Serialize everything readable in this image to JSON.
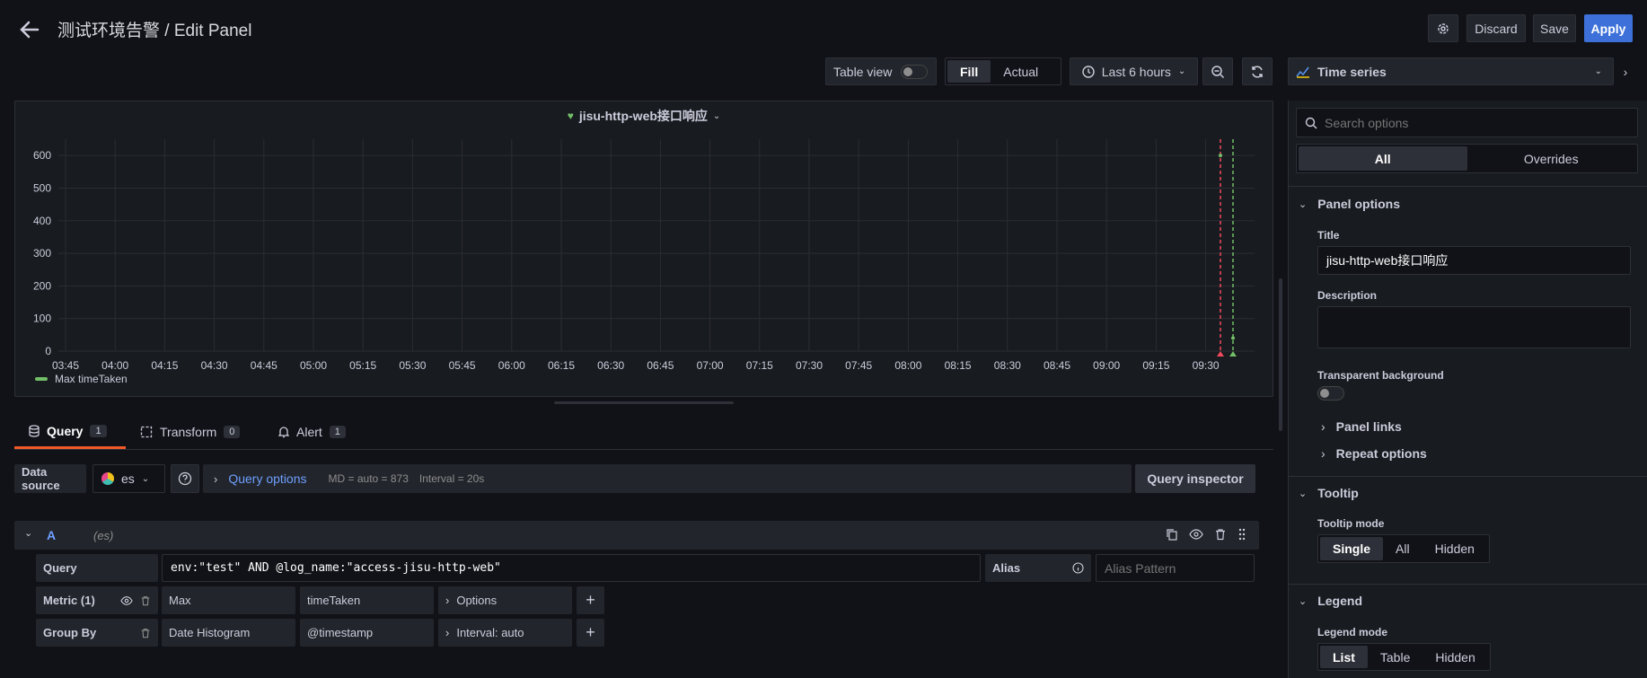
{
  "header": {
    "title": "测试环境告警 / Edit Panel",
    "discard": "Discard",
    "save": "Save",
    "apply": "Apply"
  },
  "toolbar": {
    "table_view": "Table view",
    "fill": "Fill",
    "actual": "Actual",
    "time_range": "Last 6 hours",
    "viz_type": "Time series"
  },
  "panel": {
    "title": "jisu-http-web接口响应",
    "legend": "Max timeTaken"
  },
  "chart_data": {
    "type": "line",
    "title": "jisu-http-web接口响应",
    "ylim": [
      0,
      650
    ],
    "yticks": [
      "600",
      "500",
      "400",
      "300",
      "200",
      "100",
      "0"
    ],
    "xticks": [
      "03:45",
      "04:00",
      "04:15",
      "04:30",
      "04:45",
      "05:00",
      "05:15",
      "05:30",
      "05:45",
      "06:00",
      "06:15",
      "06:30",
      "06:45",
      "07:00",
      "07:15",
      "07:30",
      "07:45",
      "08:00",
      "08:15",
      "08:30",
      "08:45",
      "09:00",
      "09:15",
      "09:30"
    ],
    "series": [
      {
        "name": "Max timeTaken",
        "color": "#73bf69"
      }
    ],
    "annotations": [
      {
        "color": "#f2495c"
      },
      {
        "color": "#73bf69"
      }
    ],
    "grid": true,
    "legend_position": "bottom-left"
  },
  "tabs": [
    {
      "label": "Query",
      "count": "1"
    },
    {
      "label": "Transform",
      "count": "0"
    },
    {
      "label": "Alert",
      "count": "1"
    }
  ],
  "datasource": {
    "label": "Data source",
    "value": "es",
    "query_options": "Query options",
    "md": "MD = auto = 873",
    "interval": "Interval = 20s",
    "inspector": "Query inspector"
  },
  "query": {
    "ref": "A",
    "ds": "(es)",
    "query_label": "Query",
    "query_value": "env:\"test\" AND @log_name:\"access-jisu-http-web\"",
    "alias_label": "Alias",
    "alias_placeholder": "Alias Pattern",
    "metric_label": "Metric (1)",
    "metric_type": "Max",
    "metric_field": "timeTaken",
    "metric_options": "Options",
    "groupby_label": "Group By",
    "groupby_type": "Date Histogram",
    "groupby_field": "@timestamp",
    "groupby_interval": "Interval: auto"
  },
  "options": {
    "search_placeholder": "Search options",
    "tab_all": "All",
    "tab_overrides": "Overrides",
    "panel_options": "Panel options",
    "title_label": "Title",
    "title_value": "jisu-http-web接口响应",
    "description_label": "Description",
    "transparent_label": "Transparent background",
    "panel_links": "Panel links",
    "repeat_options": "Repeat options",
    "tooltip": "Tooltip",
    "tooltip_mode": "Tooltip mode",
    "tooltip_modes": [
      "Single",
      "All",
      "Hidden"
    ],
    "legend": "Legend",
    "legend_mode": "Legend mode",
    "legend_modes": [
      "List",
      "Table",
      "Hidden"
    ]
  }
}
